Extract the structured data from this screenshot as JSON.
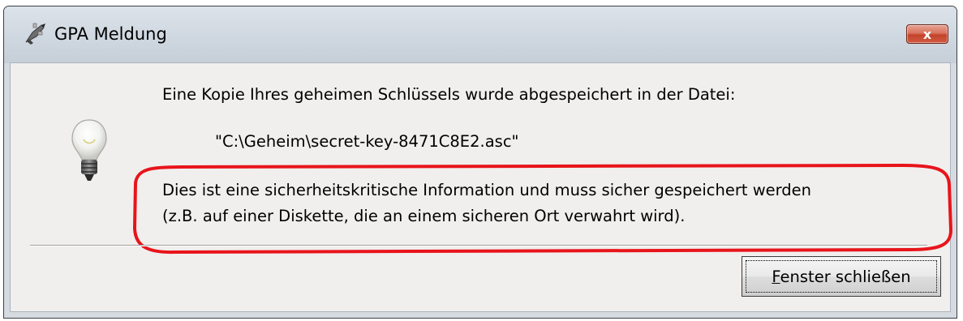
{
  "window": {
    "title": "GPA Meldung",
    "close_glyph": "x",
    "title_icon": "gpa-app-icon"
  },
  "message": {
    "line1": "Eine Kopie Ihres geheimen Schlüssels wurde abgespeichert in der Datei:",
    "file_path": "\"C:\\Geheim\\secret-key-8471C8E2.asc\"",
    "note_line1": "Dies ist eine sicherheitskritische Information und muss sicher gespeichert werden",
    "note_line2": "(z.B. auf einer Diskette, die an einem sicheren Ort verwahrt wird).",
    "icon": "lightbulb-icon",
    "highlight_color": "#e8141b"
  },
  "buttons": {
    "close_window_mnemonic": "F",
    "close_window_rest": "enster schließen"
  }
}
